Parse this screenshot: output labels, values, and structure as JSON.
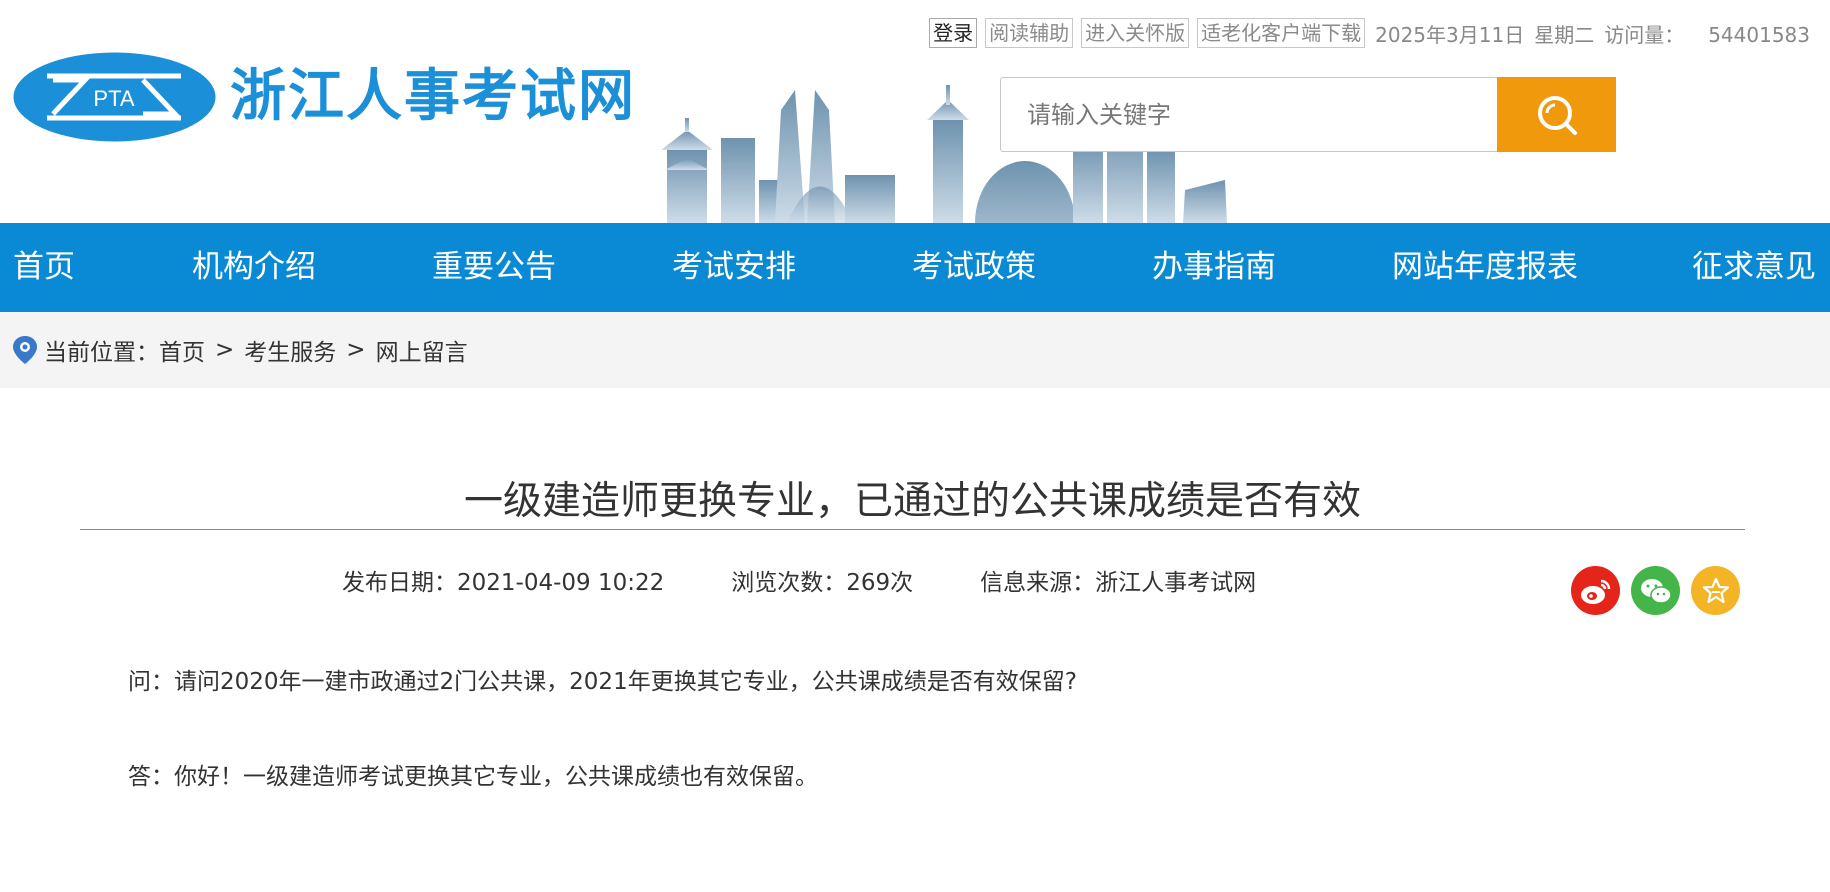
{
  "logo": {
    "abbr": "PTA",
    "site_name": "浙江人事考试网"
  },
  "top_links": [
    "登录",
    "阅读辅助",
    "进入关怀版",
    "适老化客户端下载"
  ],
  "top_info": {
    "date": "2025年3月11日",
    "weekday": "星期二",
    "visit_label": "访问量：",
    "visit_count": "54401583"
  },
  "search": {
    "placeholder": "请输入关键字"
  },
  "nav": [
    "首页",
    "机构介绍",
    "重要公告",
    "考试安排",
    "考试政策",
    "办事指南",
    "网站年度报表",
    "征求意见"
  ],
  "breadcrumb": {
    "label": "当前位置：",
    "items": [
      "首页",
      "考生服务",
      "网上留言"
    ],
    "separator": ">"
  },
  "article": {
    "title": "一级建造师更换专业，已通过的公共课成绩是否有效",
    "publish_date": "发布日期：2021-04-09 10:22",
    "views": "浏览次数：269次",
    "source": "信息来源：浙江人事考试网",
    "question": "问：请问2020年一建市政通过2门公共课，2021年更换其它专业，公共课成绩是否有效保留?",
    "answer": "答：你好！一级建造师考试更换其它专业，公共课成绩也有效保留。"
  },
  "share_icons": [
    "weibo-icon",
    "wechat-icon",
    "favorite-icon"
  ],
  "colors": {
    "brand_blue": "#0a8ad5",
    "search_orange": "#f0990d",
    "logo_blue": "#1b8fd8"
  }
}
